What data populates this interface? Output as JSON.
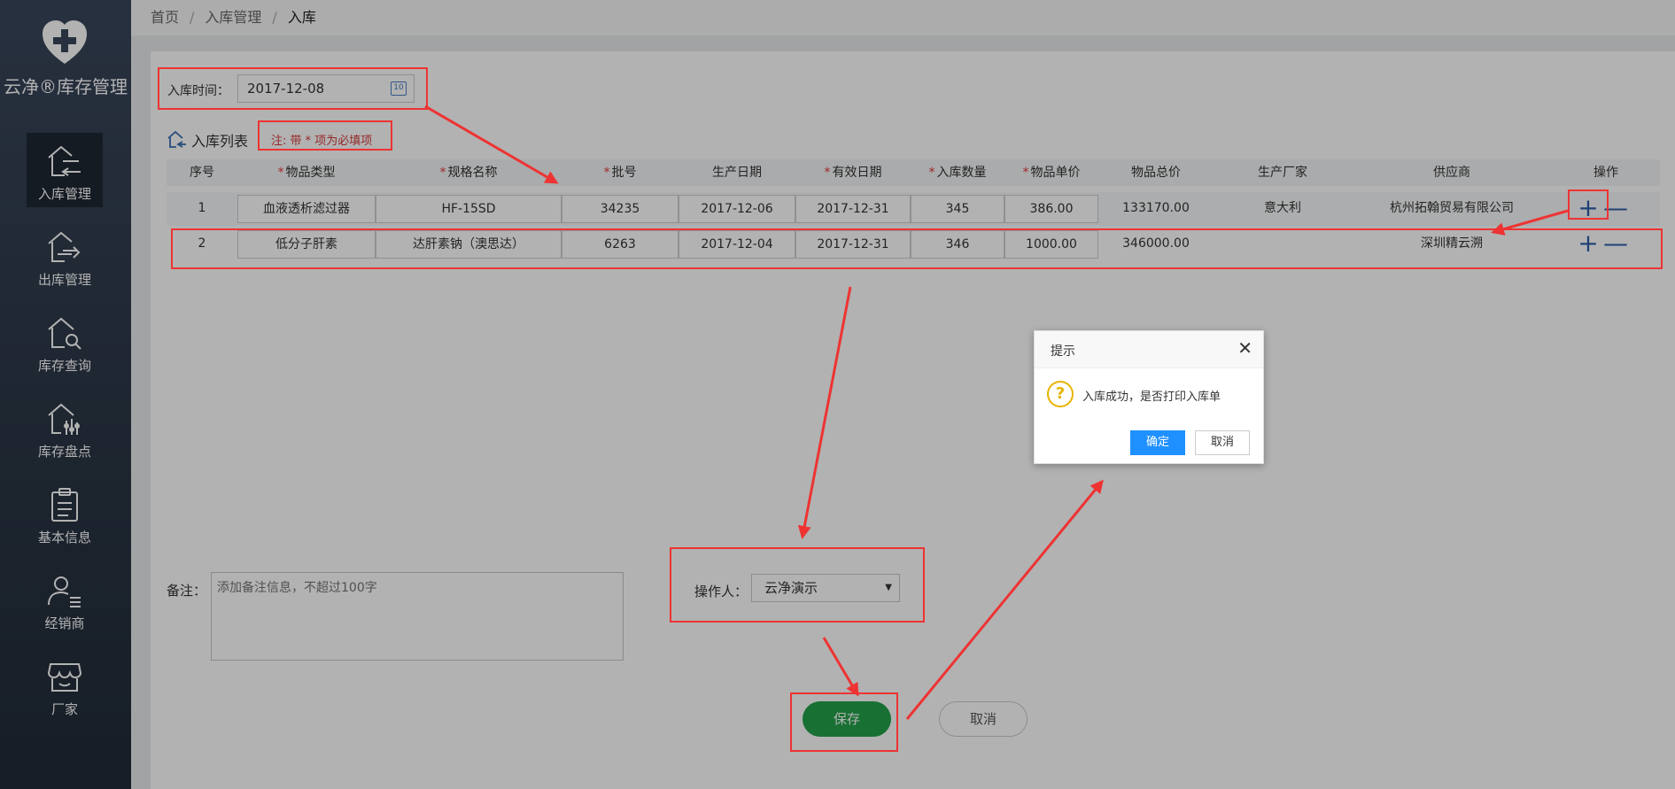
{
  "sidebar": {
    "brand_title": "云净®库存管理",
    "items": [
      {
        "label": "入库管理",
        "icon": "house-in-icon",
        "active": true
      },
      {
        "label": "出库管理",
        "icon": "house-out-icon",
        "active": false
      },
      {
        "label": "库存查询",
        "icon": "house-search-icon",
        "active": false
      },
      {
        "label": "库存盘点",
        "icon": "house-inventory-icon",
        "active": false
      },
      {
        "label": "基本信息",
        "icon": "clipboard-icon",
        "active": false
      },
      {
        "label": "经销商",
        "icon": "user-list-icon",
        "active": false
      },
      {
        "label": "厂家",
        "icon": "store-icon",
        "active": false
      }
    ]
  },
  "breadcrumb": {
    "home": "首页",
    "section": "入库管理",
    "current": "入库",
    "sep": "/"
  },
  "form": {
    "date_label": "入库时间：",
    "date_value": "2017-12-08",
    "calendar_day": "10",
    "list_title": "入库列表",
    "required_note": "注: 带 * 项为必填项"
  },
  "table": {
    "headers": [
      {
        "label": "序号",
        "required": false
      },
      {
        "label": "物品类型",
        "required": true
      },
      {
        "label": "规格名称",
        "required": true
      },
      {
        "label": "批号",
        "required": true
      },
      {
        "label": "生产日期",
        "required": false
      },
      {
        "label": "有效日期",
        "required": true
      },
      {
        "label": "入库数量",
        "required": true
      },
      {
        "label": "物品单价",
        "required": true
      },
      {
        "label": "物品总价",
        "required": false
      },
      {
        "label": "生产厂家",
        "required": false
      },
      {
        "label": "供应商",
        "required": false
      },
      {
        "label": "操作",
        "required": false
      }
    ],
    "star": "*",
    "rows": [
      {
        "no": "1",
        "type": "血液透析滤过器",
        "spec": "HF-15SD",
        "batch": "34235",
        "prod_date": "2017-12-06",
        "exp_date": "2017-12-31",
        "qty": "345",
        "price": "386.00",
        "total": "133170.00",
        "maker": "意大利",
        "supplier": "杭州拓翰贸易有限公司"
      },
      {
        "no": "2",
        "type": "低分子肝素",
        "spec": "达肝素钠（澳思达）",
        "batch": "6263",
        "prod_date": "2017-12-04",
        "exp_date": "2017-12-31",
        "qty": "346",
        "price": "1000.00",
        "total": "346000.00",
        "maker": "",
        "supplier": "深圳精云溯"
      }
    ],
    "plus": "+",
    "minus": "—"
  },
  "remark": {
    "label": "备注：",
    "placeholder": "添加备注信息，不超过100字"
  },
  "operator": {
    "label": "操作人：",
    "value": "云净演示",
    "caret": "▼"
  },
  "buttons": {
    "save": "保存",
    "cancel": "取消"
  },
  "dialog": {
    "title": "提示",
    "close": "✕",
    "icon": "?",
    "message": "入库成功，是否打印入库单",
    "ok": "确定",
    "cancel": "取消"
  },
  "colors": {
    "sidebar": "#2b3645",
    "save": "#23a14a",
    "primary": "#1e90ff",
    "annotation": "#ee3333",
    "required": "#e23c3c"
  }
}
